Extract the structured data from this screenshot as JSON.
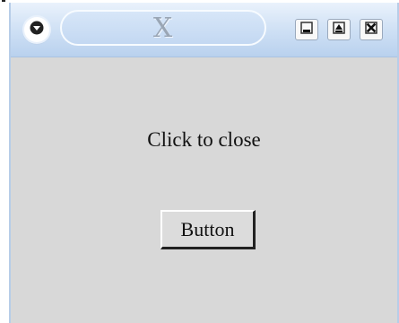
{
  "window": {
    "title": "X",
    "controls": {
      "window_menu_icon": "chevron-down-icon",
      "minimize_icon": "minimize-icon",
      "maximize_icon": "maximize-icon",
      "close_icon": "close-icon"
    },
    "colors": {
      "titlebar": "#cddff4",
      "body": "#d8d8d8"
    }
  },
  "content": {
    "label": "Click to close",
    "button_label": "Button"
  }
}
